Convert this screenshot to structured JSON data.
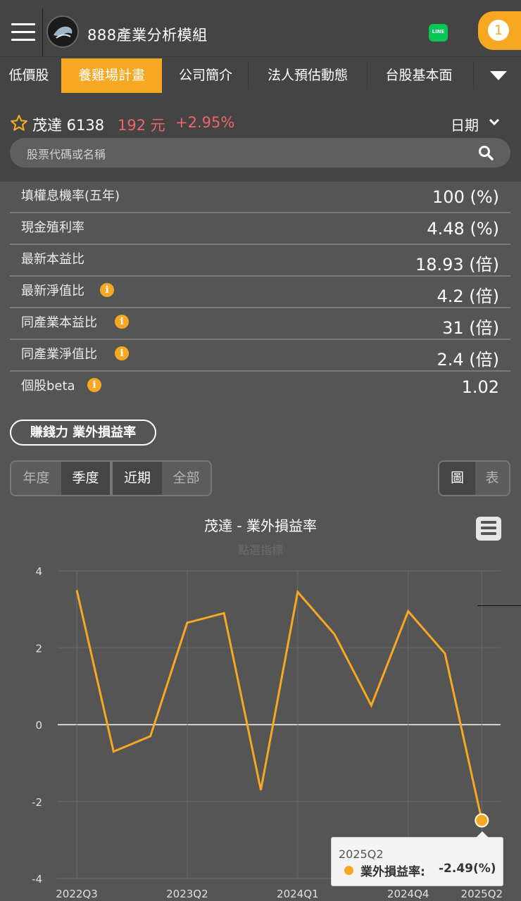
{
  "header": {
    "app_title": "888產業分析模組",
    "line_label": "LINE",
    "notification_count": "1"
  },
  "tabs": [
    "低價股",
    "養雞場計畫",
    "公司簡介",
    "法人預估動態",
    "台股基本面"
  ],
  "active_tab": "養雞場計畫",
  "stock": {
    "name_code": "茂達 6138",
    "price": "192 元",
    "change": "+2.95%",
    "date_label": "日期"
  },
  "search": {
    "placeholder": "股票代碼或名稱"
  },
  "metrics": [
    {
      "label": "填權息機率(五年)",
      "value": "100 (%)",
      "info": false
    },
    {
      "label": "現金殖利率",
      "value": "4.48 (%)",
      "info": false
    },
    {
      "label": "最新本益比",
      "value": "18.93 (倍)",
      "info": false
    },
    {
      "label": "最新淨值比",
      "value": "4.2 (倍)",
      "info": true
    },
    {
      "label": "同產業本益比",
      "value": "31 (倍)",
      "info": true
    },
    {
      "label": "同產業淨值比",
      "value": "2.4 (倍)",
      "info": true
    },
    {
      "label": "個股beta",
      "value": "1.02",
      "info": true
    }
  ],
  "section": {
    "label": "賺錢力  業外損益率"
  },
  "period_toggle": {
    "options": [
      "年度",
      "季度"
    ],
    "selected": "季度"
  },
  "range_toggle": {
    "options": [
      "近期",
      "全部"
    ],
    "selected": "近期"
  },
  "view_toggle": {
    "options": [
      "圖",
      "表"
    ],
    "selected": "圖"
  },
  "colors": {
    "accent": "#f7a823",
    "negative_red": "#f0636b",
    "background": "#555555",
    "header": "#444444"
  },
  "chart_data": {
    "type": "line",
    "title": "茂達 - 業外損益率",
    "subtitle": "點選指標",
    "x": [
      "2022Q3",
      "2022Q4",
      "2023Q1",
      "2023Q2",
      "2023Q3",
      "2023Q4",
      "2024Q1",
      "2024Q2",
      "2024Q3",
      "2024Q4",
      "2025Q1",
      "2025Q2"
    ],
    "x_tick_labels": [
      "2022Q3",
      "2023Q2",
      "2024Q1",
      "2024Q4",
      "2025Q2"
    ],
    "series": [
      {
        "name": "業外損益率",
        "values": [
          3.5,
          -0.7,
          -0.3,
          2.65,
          2.9,
          -1.7,
          3.45,
          2.35,
          0.5,
          2.95,
          1.85,
          -2.49
        ]
      }
    ],
    "y_ticks": [
      -4,
      -2,
      0,
      2,
      4
    ],
    "ylim": [
      -4,
      4
    ],
    "grid": true,
    "tooltip": {
      "category": "2025Q2",
      "series": "業外損益率:",
      "value": "-2.49(%)"
    }
  }
}
